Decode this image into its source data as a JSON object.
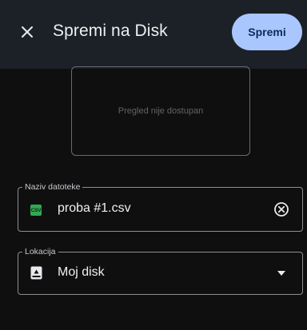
{
  "appbar": {
    "title": "Spremi na Disk",
    "save_label": "Spremi"
  },
  "preview": {
    "text": "Pregled nije dostupan"
  },
  "filename_field": {
    "label": "Naziv datoteke",
    "file_badge": "CSV",
    "value": "proba #1.csv"
  },
  "location_field": {
    "label": "Lokacija",
    "value": "Moj disk"
  },
  "colors": {
    "background": "#0f0f10",
    "appbar": "#1c2127",
    "accent_button": "#a9c6ff",
    "csv_badge": "#32a852"
  },
  "icons": {
    "close": "close-icon",
    "clear": "clear-circle-icon",
    "drive": "drive-icon",
    "dropdown": "dropdown-arrow-icon"
  }
}
